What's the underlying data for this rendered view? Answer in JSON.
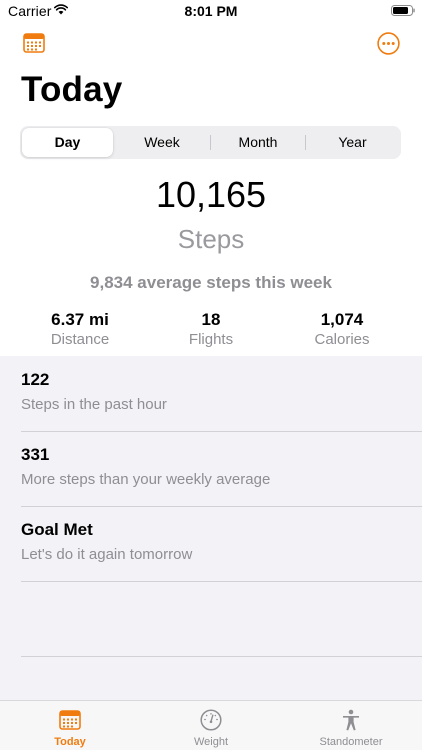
{
  "status_bar": {
    "carrier": "Carrier",
    "time": "8:01 PM",
    "wifi_icon": "wifi-icon",
    "battery_icon": "battery-icon"
  },
  "nav": {
    "left_icon": "calendar-icon",
    "right_icon": "more-ellipsis-circle-icon",
    "title": "Today"
  },
  "segments": {
    "items": [
      "Day",
      "Week",
      "Month",
      "Year"
    ],
    "selected": "Day"
  },
  "summary": {
    "steps_value": "10,165",
    "steps_unit": "Steps",
    "average_text": "9,834 average steps this week"
  },
  "stats": [
    {
      "value": "6.37 mi",
      "label": "Distance"
    },
    {
      "value": "18",
      "label": "Flights"
    },
    {
      "value": "1,074",
      "label": "Calories"
    }
  ],
  "list": [
    {
      "title": "122",
      "subtitle": "Steps in the past hour"
    },
    {
      "title": "331",
      "subtitle": "More steps than your weekly average"
    },
    {
      "title": "Goal Met",
      "subtitle": "Let's do it again tomorrow"
    }
  ],
  "tab_bar": {
    "items": [
      {
        "label": "Today",
        "icon": "calendar-icon",
        "active": true
      },
      {
        "label": "Weight",
        "icon": "scale-gauge-icon",
        "active": false
      },
      {
        "label": "Standometer",
        "icon": "standing-person-icon",
        "active": false
      }
    ]
  },
  "colors": {
    "accent": "#f07c0f",
    "secondary_text": "#8e8e93",
    "list_background": "#f2f2f7",
    "segment_background": "#eeeef0"
  }
}
